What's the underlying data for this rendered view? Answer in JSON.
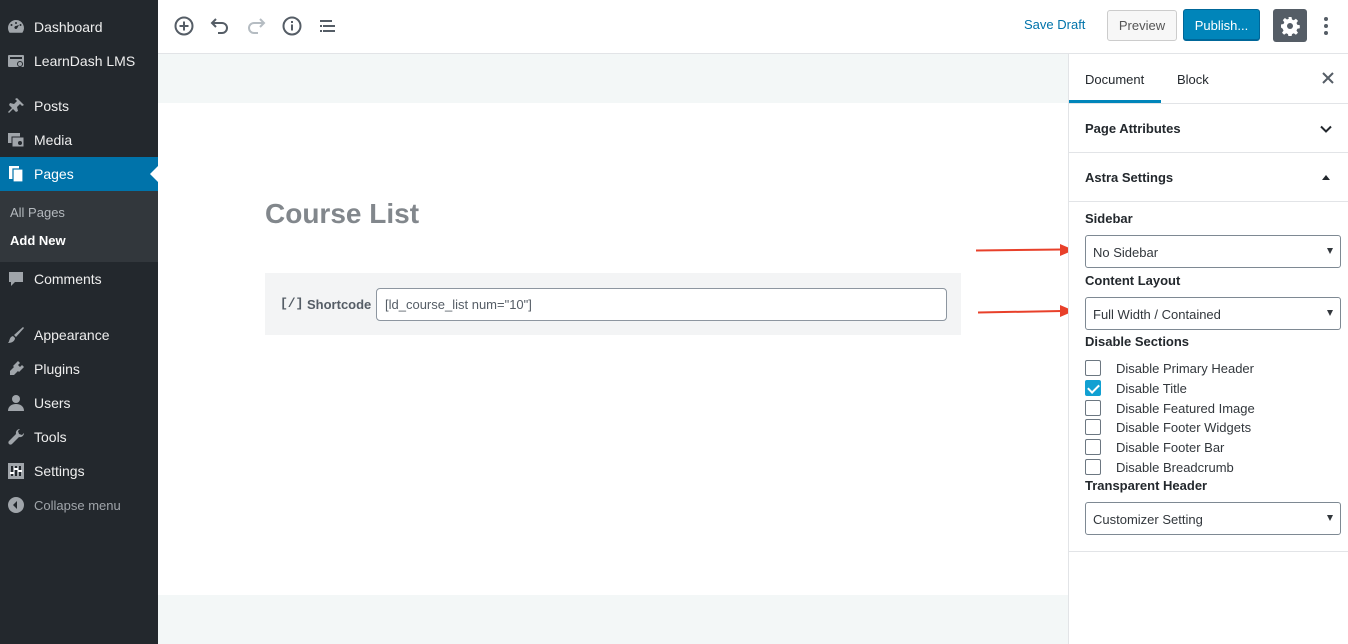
{
  "admin_menu": {
    "items": [
      {
        "label": "Dashboard",
        "icon": "dashboard-icon"
      },
      {
        "label": "LearnDash LMS",
        "icon": "learndash-icon"
      },
      {
        "label": "Posts",
        "icon": "pin-icon"
      },
      {
        "label": "Media",
        "icon": "media-icon"
      },
      {
        "label": "Pages",
        "icon": "pages-icon"
      },
      {
        "label": "Comments",
        "icon": "comment-icon"
      },
      {
        "label": "Appearance",
        "icon": "brush-icon"
      },
      {
        "label": "Plugins",
        "icon": "plug-icon"
      },
      {
        "label": "Users",
        "icon": "user-icon"
      },
      {
        "label": "Tools",
        "icon": "wrench-icon"
      },
      {
        "label": "Settings",
        "icon": "sliders-icon"
      }
    ],
    "submenu": [
      "All Pages",
      "Add New"
    ],
    "collapse_label": "Collapse menu",
    "accent_color": "#0073aa"
  },
  "toolbar": {
    "save_draft": "Save Draft",
    "preview": "Preview",
    "publish": "Publish...",
    "publish_color": "#0085ba"
  },
  "editor": {
    "title": "Course List",
    "shortcode": {
      "icon_text": "[/]",
      "label": "Shortcode",
      "value": "[ld_course_list num=\"10\"]"
    }
  },
  "panel": {
    "tabs": [
      "Document",
      "Block"
    ],
    "page_attributes": "Page Attributes",
    "astra_settings": "Astra Settings",
    "sidebar_label": "Sidebar",
    "sidebar_value": "No Sidebar",
    "content_layout_label": "Content Layout",
    "content_layout_value": "Full Width / Contained",
    "disable_sections_label": "Disable Sections",
    "checkboxes": [
      {
        "label": "Disable Primary Header",
        "checked": false
      },
      {
        "label": "Disable Title",
        "checked": true
      },
      {
        "label": "Disable Featured Image",
        "checked": false
      },
      {
        "label": "Disable Footer Widgets",
        "checked": false
      },
      {
        "label": "Disable Footer Bar",
        "checked": false
      },
      {
        "label": "Disable Breadcrumb",
        "checked": false
      }
    ],
    "transparent_header_label": "Transparent Header",
    "transparent_header_value": "Customizer Setting"
  }
}
